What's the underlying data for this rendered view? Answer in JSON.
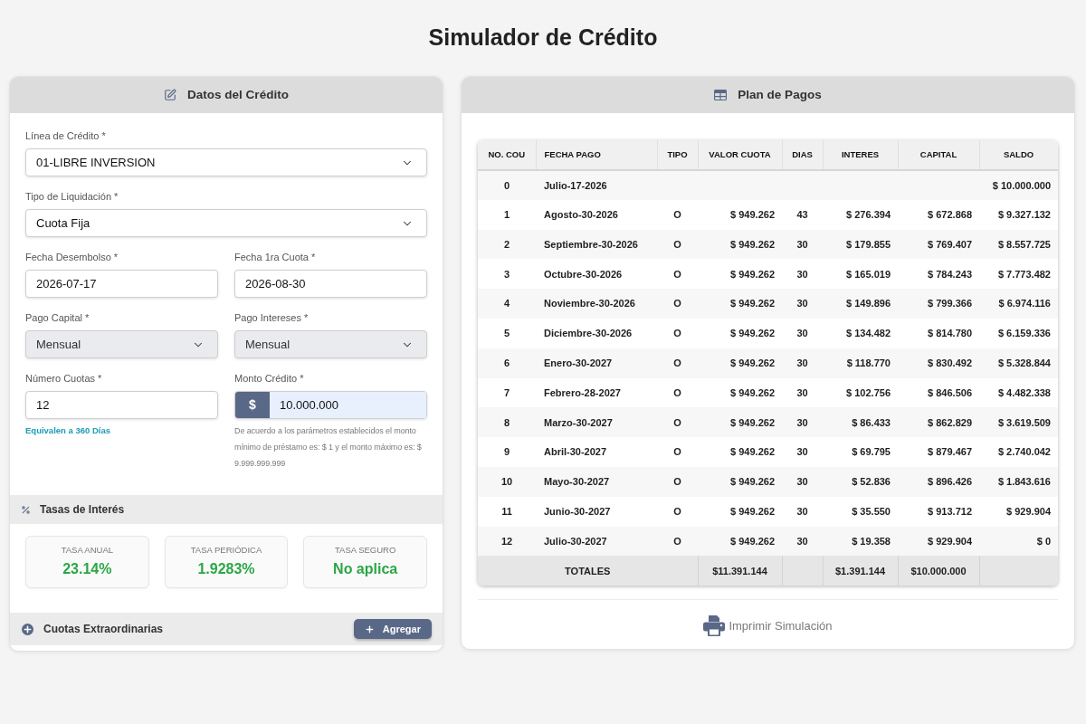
{
  "page_title": "Simulador de Crédito",
  "credit_panel": {
    "title": "Datos del Crédito",
    "rows": [
      [
        {
          "kind": "select",
          "label": "Línea de Crédito *",
          "value": "01-LIBRE INVERSION",
          "disabled": false
        }
      ],
      [
        {
          "kind": "select",
          "label": "Tipo de Liquidación *",
          "value": "Cuota Fija",
          "disabled": false
        }
      ],
      [
        {
          "kind": "date",
          "label": "Fecha Desembolso *",
          "value": "2026-07-17",
          "disabled": false
        },
        {
          "kind": "date",
          "label": "Fecha 1ra Cuota *",
          "value": "2026-08-30",
          "disabled": false
        }
      ],
      [
        {
          "kind": "select",
          "label": "Pago Capital *",
          "value": "Mensual",
          "disabled": true
        },
        {
          "kind": "select",
          "label": "Pago Intereses *",
          "value": "Mensual",
          "disabled": true
        }
      ],
      [
        {
          "kind": "number",
          "label": "Número Cuotas *",
          "value": "12",
          "disabled": false,
          "hint": "Equivalen a 360 Días"
        },
        {
          "kind": "currency",
          "label": "Monto Crédito *",
          "prefix": "$",
          "value": "10.000.000",
          "disabled": false,
          "help": "De acuerdo a los parámetros establecidos el monto mínimo de préstamo es: $ 1 y el monto máximo es: $ 9.999.999.999"
        }
      ]
    ]
  },
  "rates": {
    "title": "Tasas de Interés",
    "items": [
      {
        "label": "TASA ANUAL",
        "value": "23.14%"
      },
      {
        "label": "TASA PERIÓDICA",
        "value": "1.9283%"
      },
      {
        "label": "TASA SEGURO",
        "value": "No aplica"
      }
    ]
  },
  "extra_payments": {
    "title": "Cuotas Extraordinarias",
    "button": "Agregar"
  },
  "schedule": {
    "title": "Plan de Pagos",
    "table": {
      "columns": [
        "NO. COU",
        "FECHA PAGO",
        "TIPO",
        "VALOR CUOTA",
        "DIAS",
        "INTERES",
        "CAPITAL",
        "SALDO"
      ],
      "rows": [
        {
          "no": "0",
          "fecha_pago": "Julio-17-2026",
          "saldo": "$ 10.000.000"
        },
        {
          "no": "1",
          "fecha_pago": "Agosto-30-2026",
          "tipo": "O",
          "valor_cuota": "$ 949.262",
          "dias": "43",
          "interes": "$ 276.394",
          "capital": "$ 672.868",
          "saldo": "$ 9.327.132"
        },
        {
          "no": "2",
          "fecha_pago": "Septiembre-30-2026",
          "tipo": "O",
          "valor_cuota": "$ 949.262",
          "dias": "30",
          "interes": "$ 179.855",
          "capital": "$ 769.407",
          "saldo": "$ 8.557.725"
        },
        {
          "no": "3",
          "fecha_pago": "Octubre-30-2026",
          "tipo": "O",
          "valor_cuota": "$ 949.262",
          "dias": "30",
          "interes": "$ 165.019",
          "capital": "$ 784.243",
          "saldo": "$ 7.773.482"
        },
        {
          "no": "4",
          "fecha_pago": "Noviembre-30-2026",
          "tipo": "O",
          "valor_cuota": "$ 949.262",
          "dias": "30",
          "interes": "$ 149.896",
          "capital": "$ 799.366",
          "saldo": "$ 6.974.116"
        },
        {
          "no": "5",
          "fecha_pago": "Diciembre-30-2026",
          "tipo": "O",
          "valor_cuota": "$ 949.262",
          "dias": "30",
          "interes": "$ 134.482",
          "capital": "$ 814.780",
          "saldo": "$ 6.159.336"
        },
        {
          "no": "6",
          "fecha_pago": "Enero-30-2027",
          "tipo": "O",
          "valor_cuota": "$ 949.262",
          "dias": "30",
          "interes": "$ 118.770",
          "capital": "$ 830.492",
          "saldo": "$ 5.328.844"
        },
        {
          "no": "7",
          "fecha_pago": "Febrero-28-2027",
          "tipo": "O",
          "valor_cuota": "$ 949.262",
          "dias": "30",
          "interes": "$ 102.756",
          "capital": "$ 846.506",
          "saldo": "$ 4.482.338"
        },
        {
          "no": "8",
          "fecha_pago": "Marzo-30-2027",
          "tipo": "O",
          "valor_cuota": "$ 949.262",
          "dias": "30",
          "interes": "$ 86.433",
          "capital": "$ 862.829",
          "saldo": "$ 3.619.509"
        },
        {
          "no": "9",
          "fecha_pago": "Abril-30-2027",
          "tipo": "O",
          "valor_cuota": "$ 949.262",
          "dias": "30",
          "interes": "$ 69.795",
          "capital": "$ 879.467",
          "saldo": "$ 2.740.042"
        },
        {
          "no": "10",
          "fecha_pago": "Mayo-30-2027",
          "tipo": "O",
          "valor_cuota": "$ 949.262",
          "dias": "30",
          "interes": "$ 52.836",
          "capital": "$ 896.426",
          "saldo": "$ 1.843.616"
        },
        {
          "no": "11",
          "fecha_pago": "Junio-30-2027",
          "tipo": "O",
          "valor_cuota": "$ 949.262",
          "dias": "30",
          "interes": "$ 35.550",
          "capital": "$ 913.712",
          "saldo": "$ 929.904"
        },
        {
          "no": "12",
          "fecha_pago": "Julio-30-2027",
          "tipo": "O",
          "valor_cuota": "$ 949.262",
          "dias": "30",
          "interes": "$ 19.358",
          "capital": "$ 929.904",
          "saldo": "$ 0"
        }
      ],
      "totals": {
        "label": "TOTALES",
        "valor_cuota": "$11.391.144",
        "interes": "$1.391.144",
        "capital": "$10.000.000"
      }
    },
    "print_button": "Imprimir Simulación"
  }
}
